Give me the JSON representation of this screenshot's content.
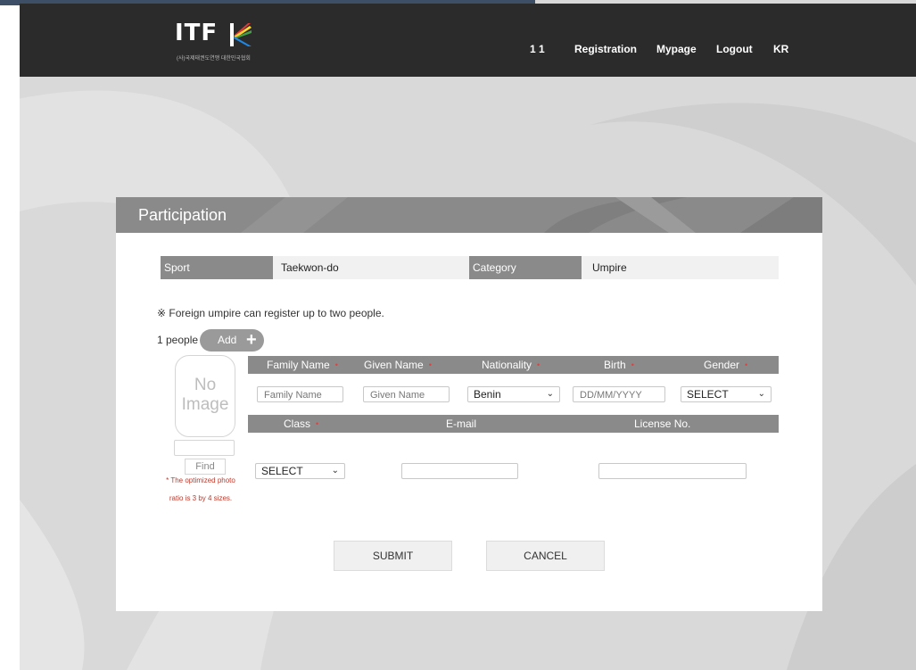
{
  "colors": {
    "header_bg": "#2b2b2b",
    "panel_header": "#8a8a8a",
    "required_dot": "#e04040",
    "note_red": "#c0392b",
    "page_bg": "#d9d9d9"
  },
  "header": {
    "logo_text": "ITF",
    "logo_subtitle": "(사)국제태권도연맹 대한민국협회",
    "nav": [
      "1 1",
      "Registration",
      "Mypage",
      "Logout",
      "KR"
    ]
  },
  "panel": {
    "title": "Participation"
  },
  "info": {
    "sport_label": "Sport",
    "sport_value": "Taekwon-do",
    "category_label": "Category",
    "category_value": "Umpire"
  },
  "notice": "※ Foreign umpire can register up to two people.",
  "people": {
    "count_label": "1 people",
    "add_label": "Add",
    "add_icon": "plus-icon"
  },
  "table": {
    "headers1": [
      "Family Name",
      "Given Name",
      "Nationality",
      "Birth",
      "Gender"
    ],
    "headers2": [
      "Class",
      "E-mail",
      "License No."
    ],
    "required_mark": "•"
  },
  "form": {
    "family_name_placeholder": "Family Name",
    "given_name_placeholder": "Given Name",
    "nationality_value": "Benin",
    "birth_placeholder": "DD/MM/YYYY",
    "gender_value": "SELECT",
    "class_value": "SELECT",
    "email_value": "",
    "license_value": ""
  },
  "photo": {
    "no_image_line1": "No",
    "no_image_line2": "Image",
    "find_label": "Find",
    "note_line1": "* The optimized photo",
    "note_line2": "ratio is 3 by 4 sizes."
  },
  "actions": {
    "submit": "SUBMIT",
    "cancel": "CANCEL"
  }
}
